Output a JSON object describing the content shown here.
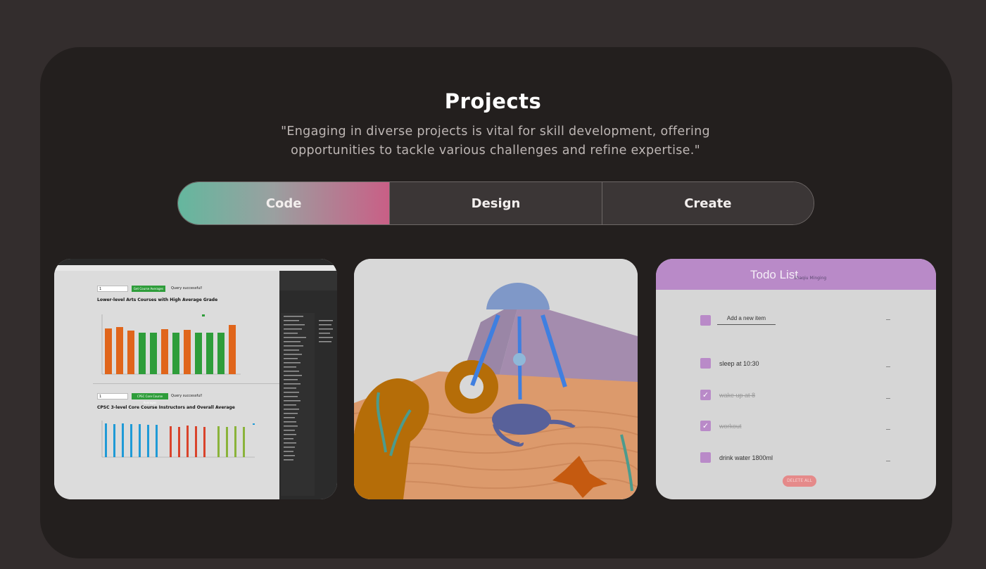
{
  "section": {
    "title": "Projects",
    "quote": "\"Engaging in diverse projects is vital for skill development, offering opportunities to tackle various challenges and refine expertise.\""
  },
  "tabs": [
    {
      "label": "Code",
      "active": true
    },
    {
      "label": "Design",
      "active": false
    },
    {
      "label": "Create",
      "active": false
    }
  ],
  "colors": {
    "page_bg": "#332d2d",
    "panel_bg": "#231f1e",
    "tab_gradient_start": "#64b79e",
    "tab_gradient_end": "#c95f86",
    "todo_accent": "#b98ac8"
  },
  "projects": [
    {
      "name": "insight-ubc-course-query",
      "screen": {
        "query_input_1": "1",
        "query_button_1": "Get Course Averages",
        "query_status_1": "Query successful!",
        "chart_title_1": "Lower-level Arts Courses with High Average Grade",
        "query_input_2": "1",
        "query_button_2": "CPSC Core Course Averages",
        "query_status_2": "Query successful!",
        "chart_title_2": "CPSC 3-level Core Course Instructors and Overall Average"
      }
    },
    {
      "name": "ocean-floor-3d-scene"
    },
    {
      "name": "todo-list-app",
      "screen": {
        "title": "Todo List",
        "subtitle": "Shaqiu Minging",
        "new_item_placeholder": "Add a new item",
        "items": [
          {
            "text": "sleep at 10:30",
            "done": false
          },
          {
            "text": "wake up at 8",
            "done": true
          },
          {
            "text": "workout",
            "done": true
          },
          {
            "text": "drink water 1800ml",
            "done": false
          }
        ],
        "delete_label": "DELETE ALL"
      }
    }
  ]
}
